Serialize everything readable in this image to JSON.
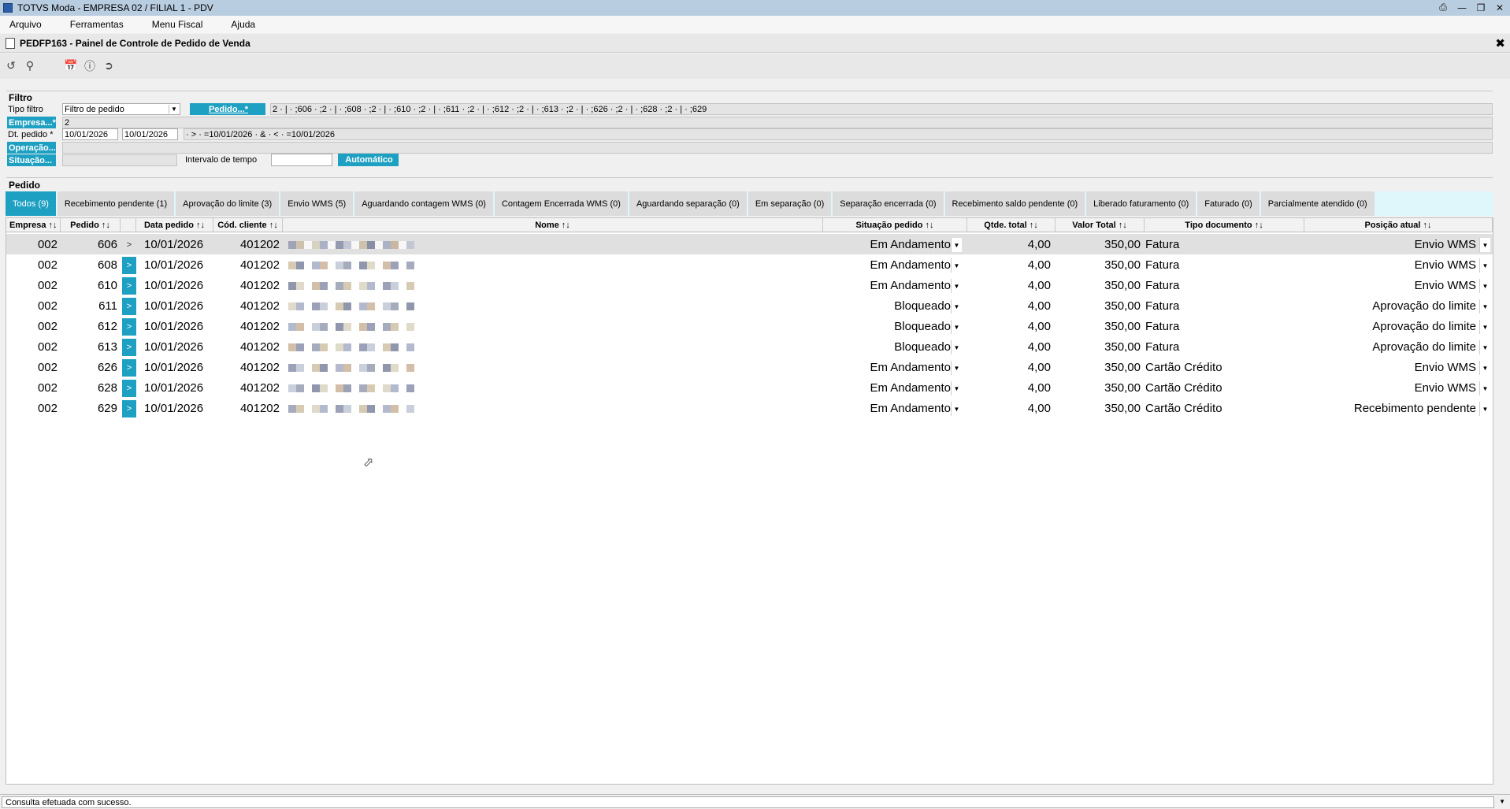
{
  "window": {
    "title": "TOTVS Moda - EMPRESA 02 / FILIAL 1 - PDV",
    "controls": [
      "printer-icon",
      "minimize-icon",
      "restore-icon",
      "close-icon"
    ]
  },
  "menu": [
    "Arquivo",
    "Ferramentas",
    "Menu Fiscal",
    "Ajuda"
  ],
  "panel": {
    "title": "PEDFP163 - Painel de Controle de Pedido de Venda"
  },
  "toolbar": {
    "icons": [
      "refresh-icon",
      "search-icon",
      "calendar-icon",
      "help-icon",
      "exit-icon"
    ]
  },
  "filter": {
    "section": "Filtro",
    "tipo_filtro_label": "Tipo filtro",
    "tipo_filtro_value": "Filtro de pedido",
    "pedido_button": "Pedido...*",
    "pedido_list": "2 · | · ;606 · ;2 · | · ;608 · ;2 · | · ;610 · ;2 · | · ;611 · ;2 · | · ;612 · ;2 · | · ;613 · ;2 · | · ;626 · ;2 · | · ;628 · ;2 · | · ;629",
    "empresa_button": "Empresa...*",
    "empresa_value": "2",
    "dt_pedido_label": "Dt. pedido *",
    "dt_from": "10/01/2026",
    "dt_to": "10/01/2026",
    "dt_expr": "· > · =10/01/2026 · & · < · =10/01/2026",
    "operacao_button": "Operação...",
    "situacao_button": "Situação...",
    "intervalo_label": "Intervalo de tempo",
    "intervalo_value": "",
    "automatico_button": "Automático"
  },
  "pedido": {
    "section": "Pedido",
    "tabs": [
      "Todos (9)",
      "Recebimento pendente (1)",
      "Aprovação do limite (3)",
      "Envio WMS (5)",
      "Aguardando contagem WMS (0)",
      "Contagem Encerrada WMS (0)",
      "Aguardando separação (0)",
      "Em separação (0)",
      "Separação encerrada (0)",
      "Recebimento saldo pendente (0)",
      "Liberado faturamento (0)",
      "Faturado (0)",
      "Parcialmente atendido (0)"
    ]
  },
  "grid": {
    "columns": [
      "Empresa ↑↓",
      "Pedido ↑↓",
      "",
      "Data pedido ↑↓",
      "Cód. cliente ↑↓",
      "Nome ↑↓",
      "Situação pedido ↑↓",
      "Qtde. total ↑↓",
      "Valor Total ↑↓",
      "Tipo documento ↑↓",
      "Posição atual ↑↓"
    ],
    "rows": [
      {
        "empresa": "002",
        "pedido": "606",
        "btn": ">",
        "data": "10/01/2026",
        "cliente": "401202",
        "situacao": "Em Andamento",
        "qtde": "4,00",
        "valor": "350,00",
        "tipo": "Fatura",
        "posicao": "Envio WMS"
      },
      {
        "empresa": "002",
        "pedido": "608",
        "btn": ">",
        "data": "10/01/2026",
        "cliente": "401202",
        "situacao": "Em Andamento",
        "qtde": "4,00",
        "valor": "350,00",
        "tipo": "Fatura",
        "posicao": "Envio WMS"
      },
      {
        "empresa": "002",
        "pedido": "610",
        "btn": ">",
        "data": "10/01/2026",
        "cliente": "401202",
        "situacao": "Em Andamento",
        "qtde": "4,00",
        "valor": "350,00",
        "tipo": "Fatura",
        "posicao": "Envio WMS"
      },
      {
        "empresa": "002",
        "pedido": "611",
        "btn": ">",
        "data": "10/01/2026",
        "cliente": "401202",
        "situacao": "Bloqueado",
        "qtde": "4,00",
        "valor": "350,00",
        "tipo": "Fatura",
        "posicao": "Aprovação do limite"
      },
      {
        "empresa": "002",
        "pedido": "612",
        "btn": ">",
        "data": "10/01/2026",
        "cliente": "401202",
        "situacao": "Bloqueado",
        "qtde": "4,00",
        "valor": "350,00",
        "tipo": "Fatura",
        "posicao": "Aprovação do limite"
      },
      {
        "empresa": "002",
        "pedido": "613",
        "btn": ">",
        "data": "10/01/2026",
        "cliente": "401202",
        "situacao": "Bloqueado",
        "qtde": "4,00",
        "valor": "350,00",
        "tipo": "Fatura",
        "posicao": "Aprovação do limite"
      },
      {
        "empresa": "002",
        "pedido": "626",
        "btn": ">",
        "data": "10/01/2026",
        "cliente": "401202",
        "situacao": "Em Andamento",
        "qtde": "4,00",
        "valor": "350,00",
        "tipo": "Cartão Crédito",
        "posicao": "Envio WMS"
      },
      {
        "empresa": "002",
        "pedido": "628",
        "btn": ">",
        "data": "10/01/2026",
        "cliente": "401202",
        "situacao": "Em Andamento",
        "qtde": "4,00",
        "valor": "350,00",
        "tipo": "Cartão Crédito",
        "posicao": "Envio WMS"
      },
      {
        "empresa": "002",
        "pedido": "629",
        "btn": ">",
        "data": "10/01/2026",
        "cliente": "401202",
        "situacao": "Em Andamento",
        "qtde": "4,00",
        "valor": "350,00",
        "tipo": "Cartão Crédito",
        "posicao": "Recebimento pendente"
      }
    ]
  },
  "status": {
    "message": "Consulta efetuada com sucesso."
  },
  "colors": {
    "accent": "#1ea0c2",
    "titlebar": "#b9cde0",
    "tabstrip": "#dff7fb"
  }
}
